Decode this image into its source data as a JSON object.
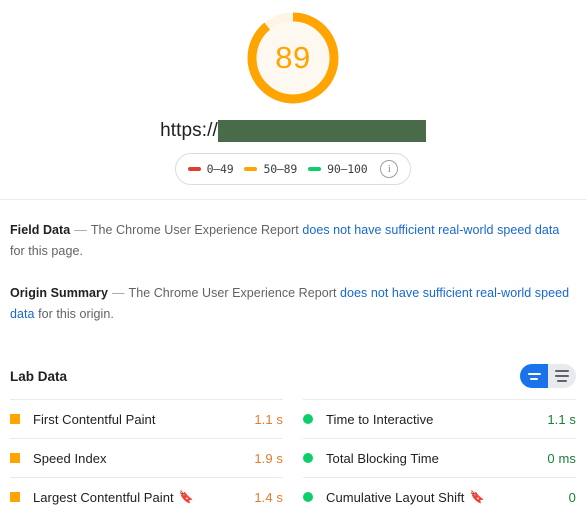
{
  "gauge": {
    "score": "89",
    "score_value": 89,
    "color": "#ffa400",
    "track_color": "#fff4e5",
    "fill_color": "#fdf8f0"
  },
  "url": {
    "scheme_text": "https://",
    "redacted": true,
    "redaction_color": "#4a6b4a"
  },
  "legend": {
    "items": [
      {
        "label": "0–49",
        "color": "#e03e2f"
      },
      {
        "label": "50–89",
        "color": "#ffa400"
      },
      {
        "label": "90–100",
        "color": "#0cce6b"
      }
    ],
    "info_icon": "info-icon",
    "info_glyph": "i"
  },
  "field_data": {
    "title": "Field Data",
    "dash": "—",
    "text_before": "The Chrome User Experience Report",
    "link_text": "does not have sufficient real-world speed data",
    "text_after": "for this page."
  },
  "origin_summary": {
    "title": "Origin Summary",
    "dash": "—",
    "text_before": "The Chrome User Experience Report",
    "link_text": "does not have sufficient real-world speed data",
    "text_after": "for this origin."
  },
  "lab_data": {
    "title": "Lab Data",
    "view_toggle": {
      "options": [
        "compact-view",
        "expanded-view"
      ],
      "selected": "compact-view"
    },
    "metrics_left": [
      {
        "name": "First Contentful Paint",
        "value": "1.1 s",
        "status": "average",
        "marker": "square",
        "flag": false
      },
      {
        "name": "Speed Index",
        "value": "1.9 s",
        "status": "average",
        "marker": "square",
        "flag": false
      },
      {
        "name": "Largest Contentful Paint",
        "value": "1.4 s",
        "status": "average",
        "marker": "square",
        "flag": true
      }
    ],
    "metrics_right": [
      {
        "name": "Time to Interactive",
        "value": "1.1 s",
        "status": "good",
        "marker": "circle",
        "flag": false
      },
      {
        "name": "Total Blocking Time",
        "value": "0 ms",
        "status": "good",
        "marker": "circle",
        "flag": false
      },
      {
        "name": "Cumulative Layout Shift",
        "value": "0",
        "status": "good",
        "marker": "circle",
        "flag": true
      }
    ]
  },
  "colors": {
    "average": "#ffa400",
    "good": "#0cce6b",
    "fail": "#e03e2f",
    "link": "#1967d2",
    "accent_blue": "#1a73e8"
  }
}
